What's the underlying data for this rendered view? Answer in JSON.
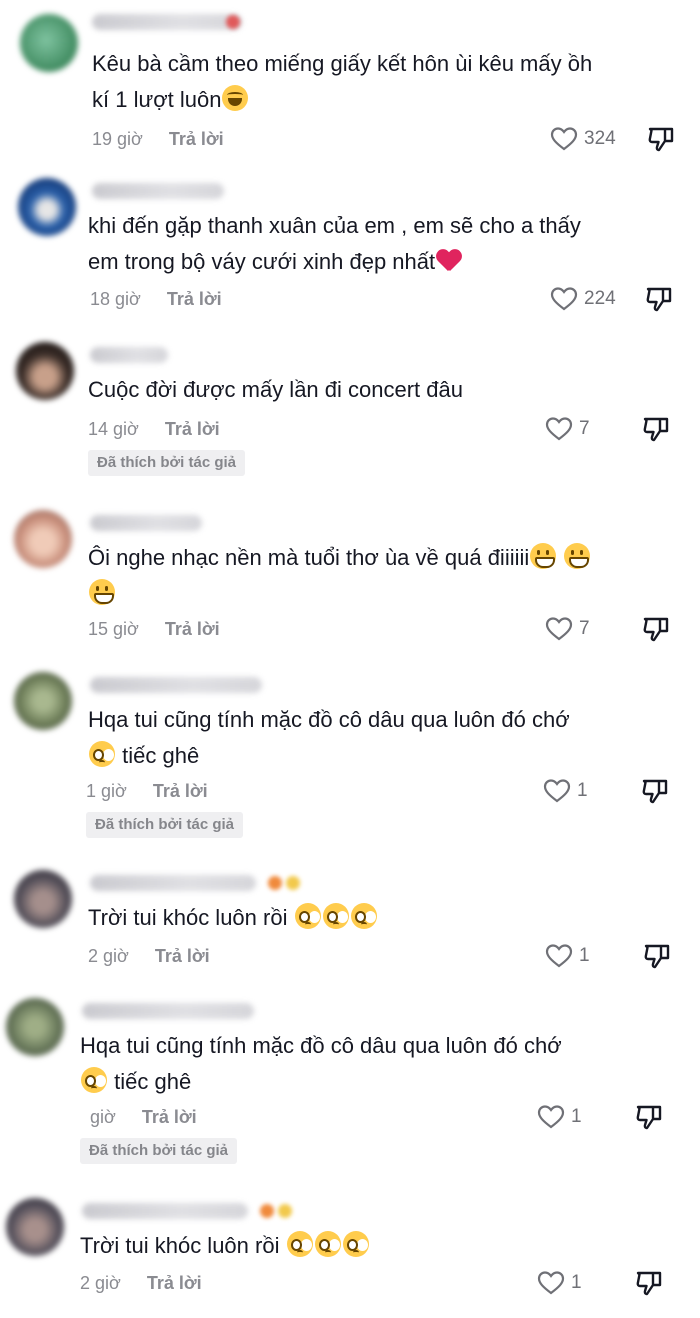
{
  "reply_label": "Trả lời",
  "liked_by_author_label": "Đã thích bởi tác giả",
  "comments": [
    {
      "avatar_color": "#3f8a5f",
      "lines": [
        "Kêu bà cầm theo miếng giấy kết hôn ùi kêu mấy ồh",
        "kí 1 lượt luôn"
      ],
      "time": "19 giờ",
      "likes": "324"
    },
    {
      "avatar_color": "#2a5fa8",
      "lines": [
        "khi đến gặp thanh xuân của em , em sẽ cho a thấy",
        "em trong bộ váy cưới xinh đẹp nhất"
      ],
      "time": "18 giờ",
      "likes": "224"
    },
    {
      "avatar_color": "#3a2d28",
      "lines": [
        "Cuộc đời được mấy lần đi concert đâu"
      ],
      "time": "14 giờ",
      "likes": "7"
    },
    {
      "avatar_color": "#c98f7c",
      "lines": [
        "Ôi nghe nhạc nền mà tuổi thơ ùa về quá điiiiii"
      ],
      "time": "15 giờ",
      "likes": "7"
    },
    {
      "avatar_color": "#6f7f5a",
      "lines": [
        "Hqa tui cũng tính mặc đồ cô dâu qua luôn đó chớ",
        "tiếc ghê"
      ],
      "time": "1 giờ",
      "likes": "1"
    },
    {
      "avatar_color": "#55505a",
      "lines": [
        "Trời tui khóc luôn rồi"
      ],
      "time": "2 giờ",
      "likes": "1"
    },
    {
      "avatar_color": "#6a7a5c",
      "lines": [
        "Hqa tui cũng tính mặc đồ cô dâu qua luôn đó chớ",
        "tiếc ghê"
      ],
      "time": "giờ",
      "likes": "1"
    },
    {
      "avatar_color": "#57525d",
      "lines": [
        "Trời tui khóc luôn rồi"
      ],
      "time": "2 giờ",
      "likes": "1"
    }
  ]
}
